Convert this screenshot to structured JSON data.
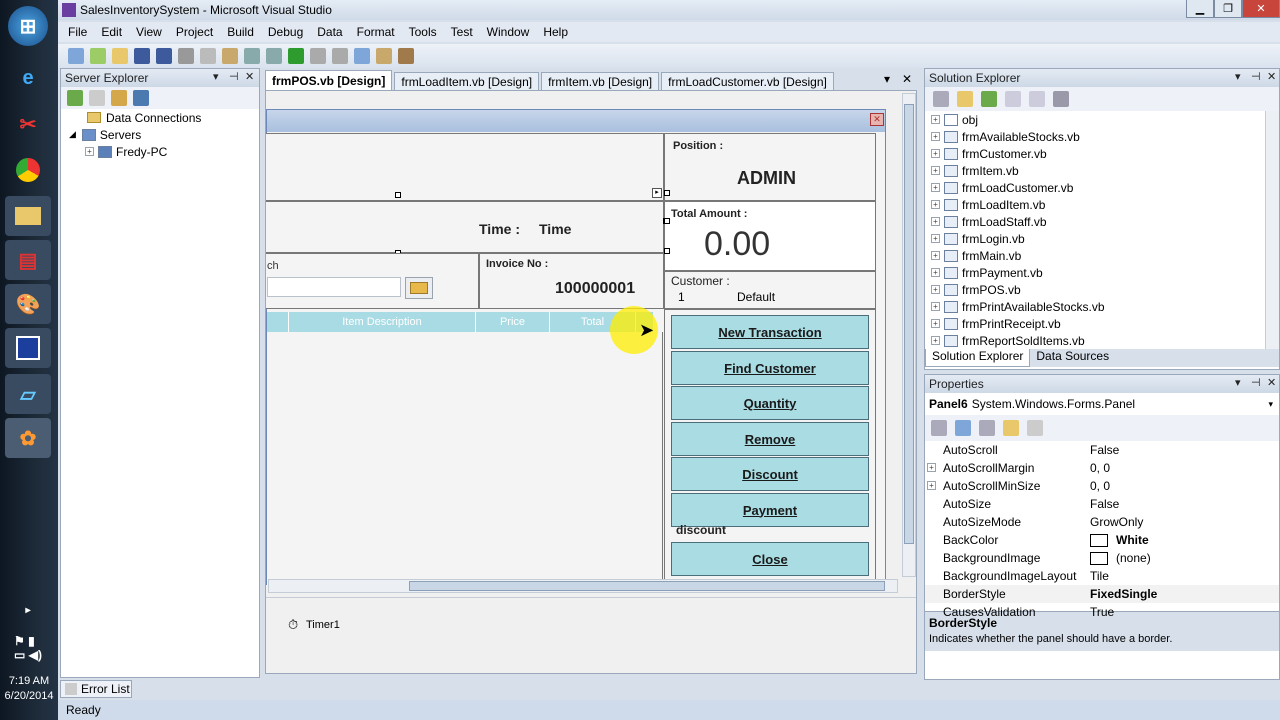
{
  "window": {
    "title": "SalesInventorySystem - Microsoft Visual Studio"
  },
  "menu": [
    "File",
    "Edit",
    "View",
    "Project",
    "Build",
    "Debug",
    "Data",
    "Format",
    "Tools",
    "Test",
    "Window",
    "Help"
  ],
  "server_explorer": {
    "title": "Server Explorer",
    "items": [
      {
        "label": "Data Connections"
      },
      {
        "label": "Servers"
      },
      {
        "label": "Fredy-PC"
      }
    ]
  },
  "doc_tabs": [
    "frmPOS.vb [Design]",
    "frmLoadItem.vb [Design]",
    "frmItem.vb [Design]",
    "frmLoadCustomer.vb [Design]"
  ],
  "form": {
    "time_label": "Time :",
    "time_value": "Time",
    "search_label_partial": "ch",
    "invoice_label": "Invoice No :",
    "invoice_value": "100000001",
    "position_label": "Position :",
    "position_value": "ADMIN",
    "total_label": "Total Amount :",
    "total_value": "0.00",
    "customer_label": "Customer :",
    "customer_id": "1",
    "customer_name": "Default",
    "grid_columns": [
      "Item Description",
      "Price",
      "Total"
    ],
    "buttons": {
      "new_transaction": "New Transaction",
      "find_customer": "Find Customer",
      "quantity": "Quantity",
      "remove": "Remove",
      "discount": "Discount",
      "payment": "Payment",
      "close": "Close"
    },
    "discount_label": "discount",
    "timer": "Timer1"
  },
  "solution_explorer": {
    "title": "Solution Explorer",
    "items": [
      "obj",
      "frmAvailableStocks.vb",
      "frmCustomer.vb",
      "frmItem.vb",
      "frmLoadCustomer.vb",
      "frmLoadItem.vb",
      "frmLoadStaff.vb",
      "frmLogin.vb",
      "frmMain.vb",
      "frmPayment.vb",
      "frmPOS.vb",
      "frmPrintAvailableStocks.vb",
      "frmPrintReceipt.vb",
      "frmReportSoldItems.vb"
    ],
    "tabs": [
      "Solution Explorer",
      "Data Sources"
    ]
  },
  "properties": {
    "title": "Properties",
    "object": "Panel6",
    "object_type": "System.Windows.Forms.Panel",
    "rows": [
      {
        "name": "AutoScroll",
        "value": "False"
      },
      {
        "name": "AutoScrollMargin",
        "value": "0, 0"
      },
      {
        "name": "AutoScrollMinSize",
        "value": "0, 0"
      },
      {
        "name": "AutoSize",
        "value": "False"
      },
      {
        "name": "AutoSizeMode",
        "value": "GrowOnly"
      },
      {
        "name": "BackColor",
        "value": "White"
      },
      {
        "name": "BackgroundImage",
        "value": "(none)"
      },
      {
        "name": "BackgroundImageLayout",
        "value": "Tile"
      },
      {
        "name": "BorderStyle",
        "value": "FixedSingle"
      },
      {
        "name": "CausesValidation",
        "value": "True"
      }
    ],
    "desc_title": "BorderStyle",
    "desc_text": "Indicates whether the panel should have a border."
  },
  "error_list": "Error List",
  "status": "Ready",
  "clock": {
    "time": "7:19 AM",
    "date": "6/20/2014"
  },
  "colors": {
    "button_bg": "#a9dce3",
    "grid_header": "#a8dbe3",
    "form_caption": "#a9c0df"
  }
}
